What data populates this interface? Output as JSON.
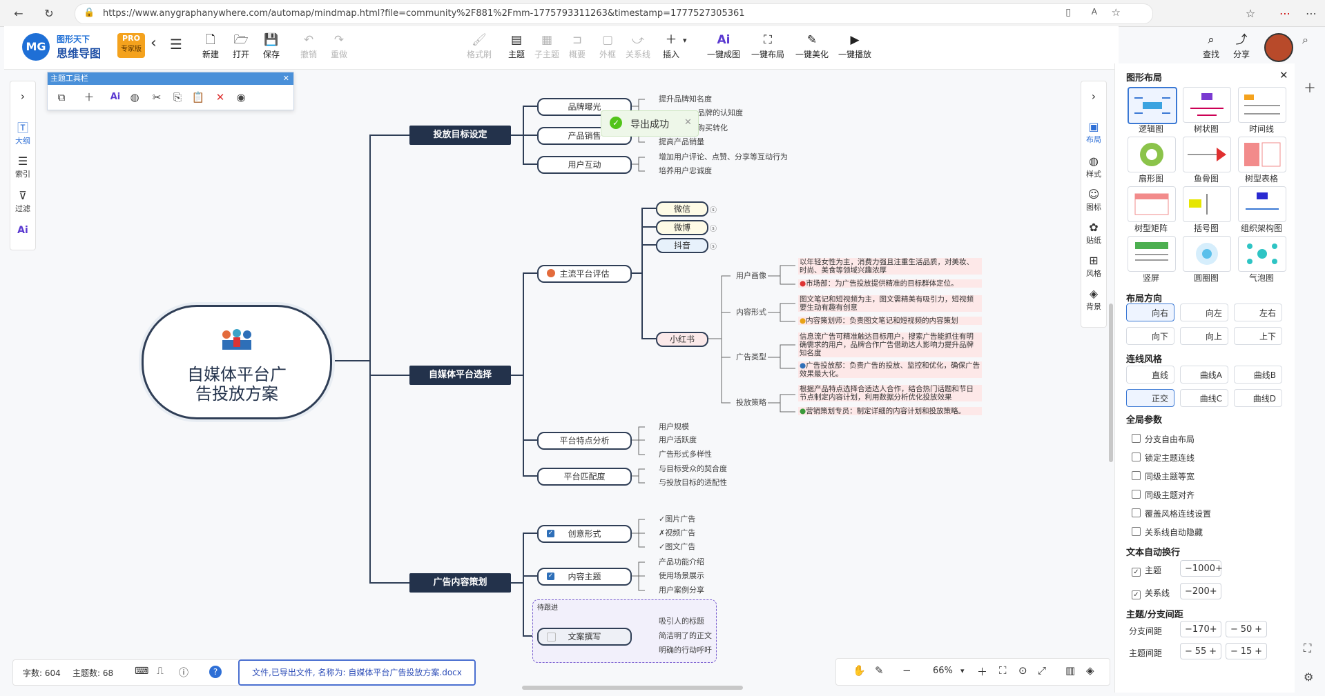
{
  "browser": {
    "url": "https://www.anygraphanywhere.com/automap/mindmap.html?file=community%2F881%2Fmm-1775793311263&timestamp=1777527305361"
  },
  "app": {
    "brand_line1": "图形天下",
    "brand_line2": "思维导图",
    "badge_top": "PRO",
    "badge_bottom": "专家版"
  },
  "toolbar": {
    "new": "新建",
    "open": "打开",
    "save": "保存",
    "undo": "撤销",
    "redo": "重做",
    "format_brush": "格式刷",
    "topic": "主题",
    "subtopic": "子主题",
    "summary": "概要",
    "outline": "外框",
    "relation": "关系线",
    "insert": "插入",
    "ai_generate": "一键成图",
    "auto_layout": "一键布局",
    "beautify": "一键美化",
    "play": "一键播放",
    "ai_text": "Ai",
    "find": "查找",
    "share": "分享"
  },
  "leftrail": {
    "outline": "大纲",
    "index": "索引",
    "filter": "过滤",
    "ai": "Ai"
  },
  "themebar": {
    "title": "主题工具栏"
  },
  "toast": {
    "text": "导出成功"
  },
  "mindmap": {
    "root": {
      "line1": "自媒体平台广",
      "line2": "告投放方案"
    },
    "branches": {
      "goal": {
        "label": "投放目标设定",
        "brand": {
          "label": "品牌曝光",
          "leaves": [
            "提升品牌知名度",
            "品牌的认知度"
          ]
        },
        "sales": {
          "label": "产品销售",
          "leaves": [
            "购买转化",
            "提高产品销量"
          ]
        },
        "interact": {
          "label": "用户互动",
          "leaves": [
            "增加用户评论、点赞、分享等互动行为",
            "培养用户忠诚度"
          ]
        }
      },
      "platform": {
        "label": "自媒体平台选择",
        "mainstream": {
          "label": "主流平台评估"
        },
        "platforms": [
          "微信",
          "微博",
          "抖音"
        ],
        "xhs": {
          "label": "小红书"
        },
        "xhs_subs": {
          "persona": {
            "label": "用户画像",
            "note": "以年轻女性为主，消费力强且注重生活品质，对美妆、时尚、美食等领域兴趣浓厚",
            "role": "市场部：为广告投放提供精准的目标群体定位。"
          },
          "content": {
            "label": "内容形式",
            "note": "图文笔记和短视频为主，图文需精美有吸引力，短视频要生动有趣有创意",
            "role": "内容策划师：负责图文笔记和短视频的内容策划"
          },
          "adtype": {
            "label": "广告类型",
            "note": "信息流广告可精准触达目标用户，搜索广告能抓住有明确需求的用户，品牌合作广告借助达人影响力提升品牌知名度",
            "role": "广告投放部：负责广告的投放、监控和优化，确保广告效果最大化。"
          },
          "strategy": {
            "label": "投放策略",
            "note": "根据产品特点选择合适达人合作，结合热门话题和节日节点制定内容计划，利用数据分析优化投放效果",
            "role": "营销策划专员：制定详细的内容计划和投放策略。"
          }
        },
        "features": {
          "label": "平台特点分析",
          "leaves": [
            "用户规模",
            "用户活跃度",
            "广告形式多样性"
          ]
        },
        "match": {
          "label": "平台匹配度",
          "leaves": [
            "与目标受众的契合度",
            "与投放目标的适配性"
          ]
        }
      },
      "content": {
        "label": "广告内容策划",
        "creative": {
          "label": "创意形式",
          "leaves": [
            "图片广告",
            "视频广告",
            "图文广告"
          ],
          "marks": [
            "✓",
            "✗",
            "✓"
          ]
        },
        "theme": {
          "label": "内容主题",
          "leaves": [
            "产品功能介绍",
            "使用场景展示",
            "用户案例分享"
          ]
        },
        "pending_tag": "待跟进",
        "copy": {
          "label": "文案撰写",
          "leaves": [
            "吸引人的标题",
            "简洁明了的正文",
            "明确的行动呼吁"
          ]
        }
      }
    }
  },
  "panel": {
    "title": "图形布局",
    "layouts": [
      "逻辑图",
      "树状图",
      "时间线",
      "扇形图",
      "鱼骨图",
      "树型表格",
      "树型矩阵",
      "括号图",
      "组织架构图",
      "竖屏",
      "圆圈图",
      "气泡图"
    ],
    "direction_title": "布局方向",
    "directions": [
      "向右",
      "向左",
      "左右",
      "向下",
      "向上",
      "上下"
    ],
    "line_title": "连线风格",
    "lines": [
      "直线",
      "曲线A",
      "曲线B",
      "正交",
      "曲线C",
      "曲线D"
    ],
    "global_title": "全局参数",
    "global_opts": [
      "分支自由布局",
      "锁定主题连线",
      "同级主题等宽",
      "同级主题对齐",
      "覆盖风格连线设置",
      "关系线自动隐藏"
    ],
    "wrap_title": "文本自动换行",
    "wrap_topic": "主题",
    "wrap_topic_val": "1000",
    "wrap_rel": "关系线",
    "wrap_rel_val": "200",
    "spacing_title": "主题/分支间距",
    "branch_spacing": "分支间距",
    "branch_v1": "170",
    "branch_v2": "50",
    "topic_spacing": "主题间距",
    "topic_v1": "55",
    "topic_v2": "15"
  },
  "rightrail": {
    "layout": "布局",
    "style": "样式",
    "icon": "图标",
    "sticker": "贴纸",
    "theme": "风格",
    "background": "背景"
  },
  "status": {
    "words": "字数: 604",
    "topics": "主题数: 68"
  },
  "export_msg": "文件,已导出文件, 名称为: 自媒体平台广告投放方案.docx",
  "zoom": {
    "level": "66%"
  },
  "colors": {
    "dark_node": "#23324b",
    "accent": "#3a78d4",
    "note_bg": "#fde8e8"
  }
}
